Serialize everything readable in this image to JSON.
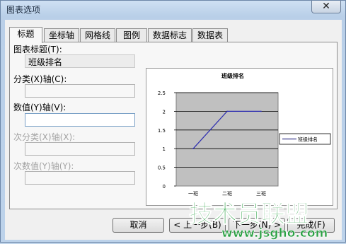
{
  "window": {
    "title": "图表选项",
    "close_glyph": "✕"
  },
  "tabs": [
    {
      "label": "标题",
      "active": true
    },
    {
      "label": "坐标轴",
      "active": false
    },
    {
      "label": "网格线",
      "active": false
    },
    {
      "label": "图例",
      "active": false
    },
    {
      "label": "数据标志",
      "active": false
    },
    {
      "label": "数据表",
      "active": false
    }
  ],
  "fields": {
    "chart_title": {
      "label": "图表标题(T):",
      "value": "班级排名"
    },
    "category_x": {
      "label": "分类(X)轴(C):",
      "value": ""
    },
    "value_y": {
      "label": "数值(Y)轴(V):",
      "value": ""
    },
    "secondary_category_x": {
      "label": "次分类(X)轴(X):",
      "value": ""
    },
    "secondary_value_y": {
      "label": "次数值(Y)轴(Y):",
      "value": ""
    }
  },
  "preview": {
    "legend_line_color": "#3a3a8c"
  },
  "chart_data": {
    "type": "line",
    "title": "班级排名",
    "categories": [
      "一班",
      "二班",
      "三班"
    ],
    "series": [
      {
        "name": "班级排名",
        "values": [
          1,
          2,
          2
        ],
        "color": "#2b2bb0"
      }
    ],
    "ylim": [
      0,
      2.5
    ],
    "yticks": [
      "0",
      "0.5",
      "1",
      "1.5",
      "2",
      "2.5"
    ],
    "grid": true,
    "plot_background": "#c0c0c0",
    "legend_position": "right"
  },
  "buttons": {
    "cancel": "取消",
    "prev": "< 上一步(B)",
    "next": "下一步(N) >",
    "finish": "完成(F)"
  },
  "watermark": {
    "text": "技术员联盟",
    "url": "www.jsgho.com",
    "color": "#2aa043"
  }
}
